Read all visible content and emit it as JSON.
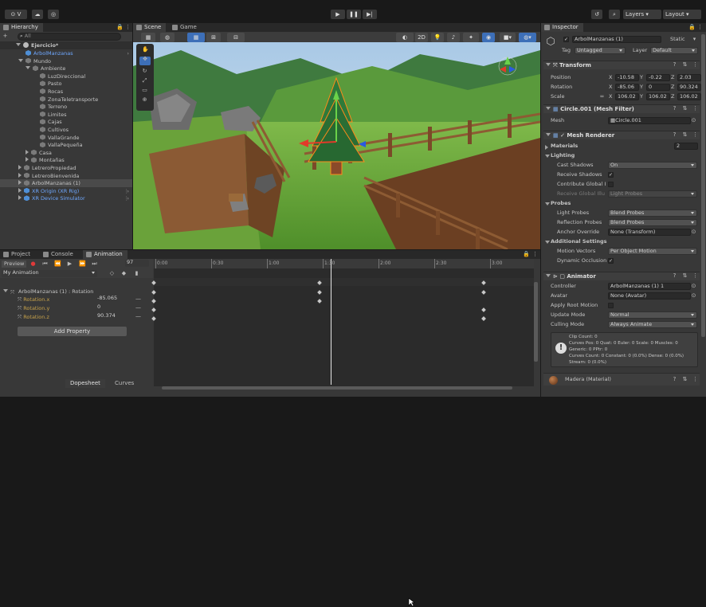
{
  "toolbar": {
    "account_label": "V",
    "play_icon": "play-icon",
    "layers_label": "Layers",
    "layout_label": "Layout"
  },
  "hierarchy": {
    "tab": "Hierarchy",
    "search_placeholder": "All",
    "scene": "Ejercicio*",
    "items": [
      {
        "label": "ArbolManzanas",
        "color": "#6fa8ff"
      },
      {
        "label": "Mundo"
      },
      {
        "label": "Ambiente"
      },
      {
        "label": "LuzDireccional"
      },
      {
        "label": "Pasto"
      },
      {
        "label": "Rocas"
      },
      {
        "label": "ZonaTeletransporte"
      },
      {
        "label": "Terreno"
      },
      {
        "label": "Limites"
      },
      {
        "label": "Cajas"
      },
      {
        "label": "Cultivos"
      },
      {
        "label": "VallaGrande"
      },
      {
        "label": "VallaPequeña"
      },
      {
        "label": "Casa"
      },
      {
        "label": "Montañas"
      },
      {
        "label": "LetreroPropiedad"
      },
      {
        "label": "LetreroBienvenida"
      },
      {
        "label": "ArbolManzanas (1)"
      },
      {
        "label": "XR Origin (XR Rig)",
        "color": "#6fa8ff"
      },
      {
        "label": "XR Device Simulator",
        "color": "#6fa8ff"
      }
    ]
  },
  "scene_view": {
    "tabs": [
      "Scene",
      "Game"
    ],
    "mode_2d": "2D"
  },
  "bottom": {
    "tabs": [
      "Project",
      "Console",
      "Animation"
    ],
    "preview": "Preview",
    "frame": "97",
    "clip": "My Animation",
    "property_group": "ArbolManzanas (1) : Rotation",
    "properties": [
      {
        "name": "Rotation.x",
        "value": "-85.065"
      },
      {
        "name": "Rotation.y",
        "value": "0"
      },
      {
        "name": "Rotation.z",
        "value": "90.374"
      }
    ],
    "add_property": "Add Property",
    "timeline_ticks": [
      "0:00",
      "0:30",
      "1:00",
      "1:30",
      "2:00",
      "2:30",
      "3:00"
    ],
    "dopesheet": "Dopesheet",
    "curves": "Curves"
  },
  "inspector": {
    "tab": "Inspector",
    "object_name": "ArbolManzanas (1)",
    "static_label": "Static",
    "tag_label": "Tag",
    "tag_value": "Untagged",
    "layer_label": "Layer",
    "layer_value": "Default",
    "transform": {
      "title": "Transform",
      "position_label": "Position",
      "position": {
        "x": "-10.58",
        "y": "-0.22",
        "z": "2.03"
      },
      "rotation_label": "Rotation",
      "rotation": {
        "x": "-85.06",
        "y": "0",
        "z": "90.324"
      },
      "scale_label": "Scale",
      "scale": {
        "x": "106.02",
        "y": "106.02",
        "z": "106.02"
      }
    },
    "mesh_filter": {
      "title": "Circle.001 (Mesh Filter)",
      "mesh_label": "Mesh",
      "mesh_value": "Circle.001"
    },
    "mesh_renderer": {
      "title": "Mesh Renderer",
      "materials_label": "Materials",
      "materials_count": "2",
      "lighting": "Lighting",
      "cast_shadows_label": "Cast Shadows",
      "cast_shadows": "On",
      "receive_shadows_label": "Receive Shadows",
      "contribute_gi_label": "Contribute Global I",
      "receive_gi_label": "Receive Global Illu",
      "receive_gi_value": "Light Probes",
      "probes": "Probes",
      "light_probes_label": "Light Probes",
      "light_probes": "Blend Probes",
      "reflection_probes_label": "Reflection Probes",
      "reflection_probes": "Blend Probes",
      "anchor_label": "Anchor Override",
      "anchor_value": "None (Transform)",
      "additional": "Additional Settings",
      "motion_label": "Motion Vectors",
      "motion_value": "Per Object Motion",
      "occlusion_label": "Dynamic Occlusion"
    },
    "animator": {
      "title": "Animator",
      "controller_label": "Controller",
      "controller_value": "ArbolManzanas (1) 1",
      "avatar_label": "Avatar",
      "avatar_value": "None (Avatar)",
      "root_motion_label": "Apply Root Motion",
      "update_label": "Update Mode",
      "update_value": "Normal",
      "culling_label": "Culling Mode",
      "culling_value": "Always Animate",
      "info": [
        "Clip Count: 0",
        "Curves Pos: 0 Quat: 0 Euler: 0 Scale: 0 Muscles: 0",
        "Generic: 0 PPtr: 0",
        "Curves Count: 0 Constant: 0 (0.0%) Dense: 0 (0.0%)",
        "Stream: 0 (0.0%)"
      ]
    },
    "material": "Madera (Material)"
  }
}
